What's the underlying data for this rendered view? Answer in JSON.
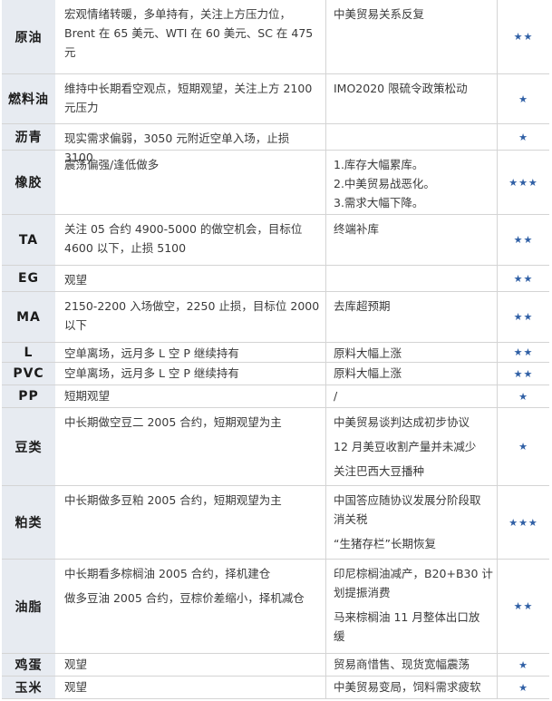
{
  "rows": [
    {
      "name": "原油",
      "view": [
        "宏观情绪转暖，多单持有，关注上方压力位，",
        "Brent 在 65 美元、WTI 在 60 美元、SC 在 475",
        "元"
      ],
      "factors": [
        "中美贸易关系反复"
      ],
      "stars": "★★"
    },
    {
      "name": "燃料油",
      "view": [
        "维持中长期看空观点，短期观望，关注上方 2100",
        "元压力"
      ],
      "factors": [
        "IMO2020 限硫令政策松动"
      ],
      "stars": "★"
    },
    {
      "name": "沥青",
      "view": [
        "现实需求偏弱，3050 元附近空单入场，止损 3100"
      ],
      "factors": [],
      "stars": "★"
    },
    {
      "name": "橡胶",
      "view": [
        "震荡偏强/逢低做多"
      ],
      "factors": [
        "1.库存大幅累库。",
        "2.中美贸易战恶化。",
        "3.需求大幅下降。"
      ],
      "stars": "★★★"
    },
    {
      "name": "TA",
      "view": [
        "关注 05 合约 4900-5000 的做空机会，目标位",
        "4600 以下，止损 5100"
      ],
      "factors": [
        "终端补库"
      ],
      "stars": "★★"
    },
    {
      "name": "EG",
      "view": [
        "观望"
      ],
      "factors": [],
      "stars": "★★"
    },
    {
      "name": "MA",
      "view": [
        "2150-2200 入场做空，2250 止损，目标位 2000",
        "以下"
      ],
      "factors": [
        "去库超预期"
      ],
      "stars": "★★"
    },
    {
      "name": "L",
      "view": [
        "空单离场，远月多 L 空 P 继续持有"
      ],
      "factors": [
        "原料大幅上涨"
      ],
      "stars": "★★"
    },
    {
      "name": "PVC",
      "view": [
        "空单离场，远月多 L 空 P 继续持有"
      ],
      "factors": [
        "原料大幅上涨"
      ],
      "stars": "★★"
    },
    {
      "name": "PP",
      "view": [
        "短期观望"
      ],
      "factors": [
        "/"
      ],
      "stars": "★"
    },
    {
      "name": "豆类",
      "view": [
        "中长期做空豆二 2005 合约，短期观望为主"
      ],
      "factors": [
        "中美贸易谈判达成初步协议",
        "12 月美豆收割产量并未减少",
        "关注巴西大豆播种"
      ],
      "stars": "★"
    },
    {
      "name": "粕类",
      "view": [
        "中长期做多豆粕 2005 合约，短期观望为主"
      ],
      "factors": [
        "中国答应随协议发展分阶段取\n消关税",
        "“生猪存栏”长期恢复"
      ],
      "stars": "★★★"
    },
    {
      "name": "油脂",
      "view": [
        "中长期看多棕榈油 2005 合约，择机建仓",
        "做多豆油 2005 合约，豆棕价差缩小，择机减仓"
      ],
      "factors": [
        "印尼棕榈油减产，B20+B30 计\n划提振消费",
        "马来棕榈油 11 月整体出口放\n缓"
      ],
      "stars": "★★"
    },
    {
      "name": "鸡蛋",
      "view": [
        "观望"
      ],
      "factors": [
        "贸易商惜售、现货宽幅震荡"
      ],
      "stars": "★"
    },
    {
      "name": "玉米",
      "view": [
        "观望"
      ],
      "factors": [
        "中美贸易变局，饲料需求疲软"
      ],
      "stars": "★"
    }
  ]
}
